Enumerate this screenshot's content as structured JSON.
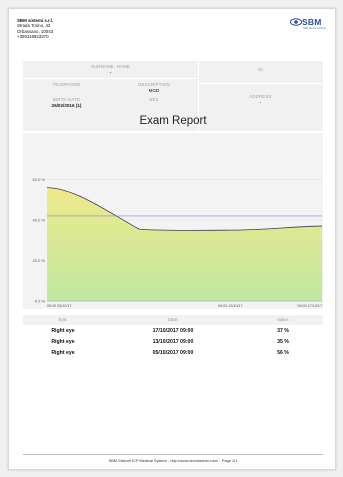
{
  "company": {
    "name": "SBM sistemi s.r.l.",
    "street": "Strada Torino, 43",
    "city": "Orbassano, 10043",
    "phone": "+390119923370"
  },
  "logo": {
    "text": "SBM",
    "subtext": "SBM Sistemi Medical"
  },
  "patient": {
    "surname_label": "SURNAME, NAME",
    "surname_value": "-",
    "id_label": "ID",
    "id_value": "",
    "telephone_label": "TELEPHONE",
    "telephone_value": "",
    "description_label": "DESCRIPTION",
    "description_value": "MGD",
    "address_label": "ADDRESS",
    "address_value": "-",
    "birth_label": "BIRTH DATE",
    "birth_value": "26/02/2016 (1)",
    "sex_label": "SEX",
    "sex_value": ""
  },
  "report_title": "Exam Report",
  "chart_data": {
    "type": "area",
    "y_tick_labels": [
      "0.0 %",
      "20.0 %",
      "40.0 %",
      "60.0 %"
    ],
    "x_tick_labels": [
      "09:00 05/10/17",
      "09:00 13/10/17",
      "09:00 17/10/17"
    ],
    "ylim": [
      0,
      80
    ],
    "grid": true,
    "series": [
      {
        "values": [
          {
            "x": 0,
            "y": 56
          },
          {
            "x": 8,
            "y": 35
          },
          {
            "x": 12,
            "y": 37
          }
        ]
      }
    ],
    "reference_line": 42,
    "colors": {
      "line": "#3a3a5a",
      "ref_line": "#7f7fe0",
      "fill_top": "#efe98a",
      "fill_bottom": "#bfe8a2",
      "grid": "#e2e2e2"
    }
  },
  "table": {
    "headers": {
      "eye": "Eye:",
      "date": "Date:",
      "value": "Value:"
    },
    "rows": [
      {
        "eye": "Right eye",
        "date": "17/10/2017 09:00",
        "value": "37 %"
      },
      {
        "eye": "Right eye",
        "date": "13/10/2017 09:00",
        "value": "35 %"
      },
      {
        "eye": "Right eye",
        "date": "05/10/2017 09:00",
        "value": "56 %"
      }
    ]
  },
  "footer": "SBM Sistemi ICP Medical System - http://www.sbmsistemi.com/ - Page 1/1"
}
